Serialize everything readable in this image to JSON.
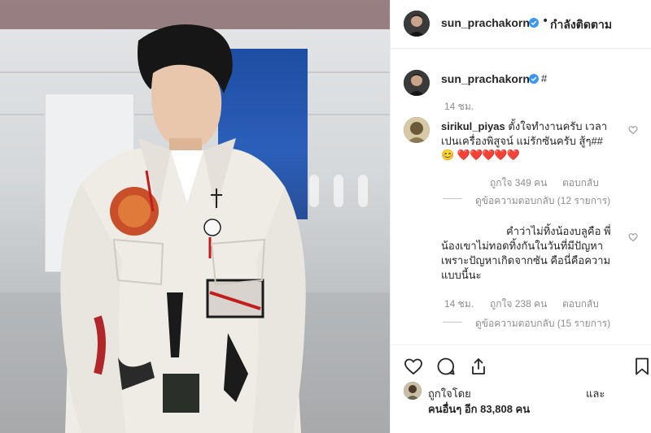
{
  "post": {
    "author": "sun_prachakorn",
    "follow_status": "กำลังติดตาม",
    "separator": "•",
    "caption_author": "sun_prachakorn",
    "caption_text": "#",
    "caption_time": "14 ชม."
  },
  "comments": [
    {
      "username": "sirikul_piyas",
      "text_line1": "ตั้งใจทำงานครับ เวลา",
      "text_line2": "เปนเครื่องพิสูจน์ แม่รักซันครับ สู้ๆ##",
      "text_line3_emoji": "😊",
      "hearts": "❤️❤️❤️❤️❤️",
      "likes": "ถูกใจ 349 คน",
      "reply": "ตอบกลับ",
      "view_replies": "ดูข้อความตอบกลับ (12 รายการ)"
    },
    {
      "text_line1": "คำว่าไม่ทิ้งน้องบลูคือ พี่",
      "text_line2": "น้องเขาไม่ทอดทิ้งกันในวันที่มีปัญหา",
      "text_line3": "เพราะปัญหาเกิดจากซัน คือนี่คือความ",
      "text_line4": "แบบนี้นะ",
      "time": "14 ชม.",
      "likes": "ถูกใจ 238 คน",
      "reply": "ตอบกลับ",
      "view_replies": "ดูข้อความตอบกลับ (15 รายการ)"
    }
  ],
  "actions": {
    "like_icon": "heart-outline-icon",
    "comment_icon": "comment-bubble-icon",
    "share_icon": "share-upload-icon",
    "save_icon": "bookmark-icon"
  },
  "likes_summary": {
    "liked_by": "ถูกใจโดย",
    "and": "และ",
    "others": "คนอื่นๆ อีก 83,808 คน"
  },
  "colors": {
    "verified": "#3897f0",
    "text": "#262626",
    "muted": "#8e8e8e",
    "heart": "#ed4956"
  }
}
